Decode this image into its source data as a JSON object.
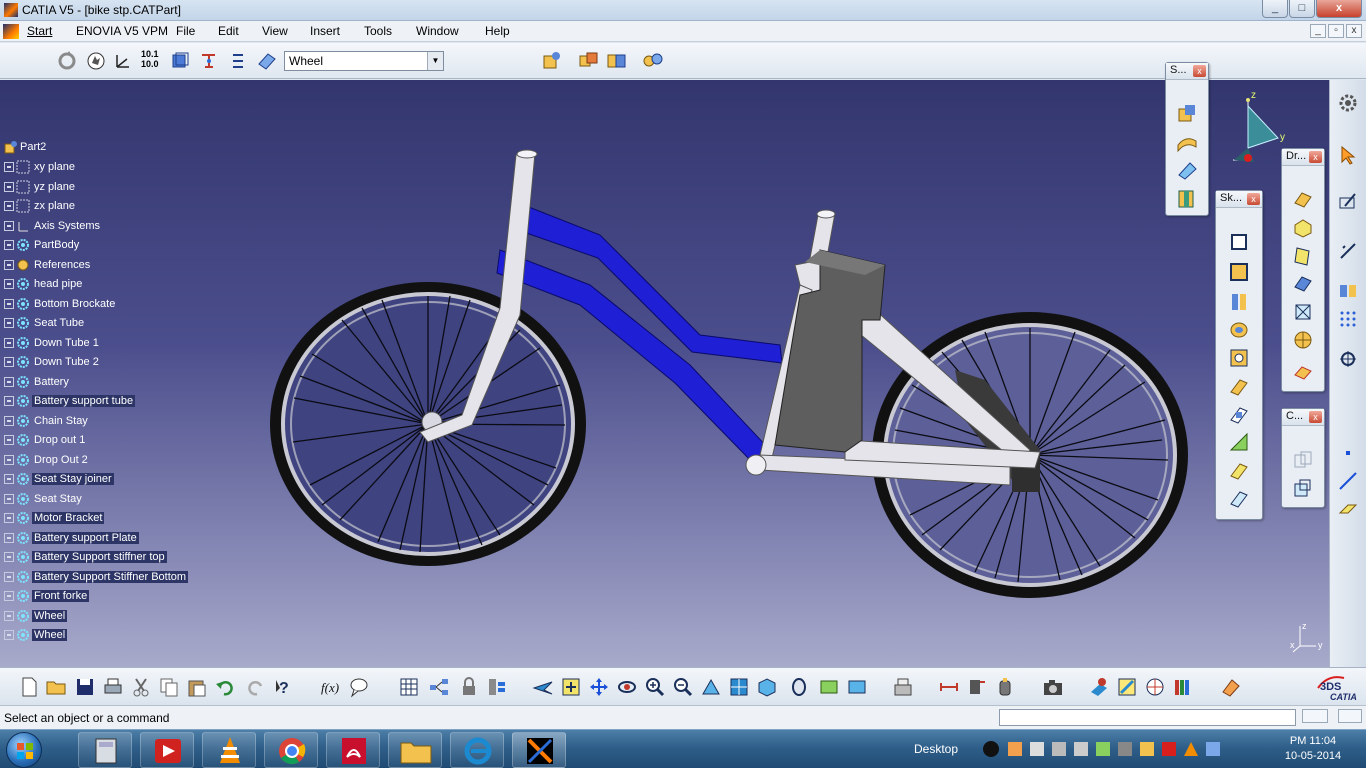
{
  "window": {
    "title": "CATIA V5 - [bike stp.CATPart]",
    "controls": {
      "minimize": "_",
      "restore": "□",
      "close": "x"
    }
  },
  "menu": {
    "items": [
      "Start",
      "ENOVIA V5 VPM",
      "File",
      "Edit",
      "View",
      "Insert",
      "Tools",
      "Window",
      "Help"
    ],
    "mdi": {
      "minimize": "_",
      "restore": "▫",
      "close": "x"
    }
  },
  "toolbar": {
    "selection_value": "Wheel",
    "select_arrow": "▼"
  },
  "tree": {
    "root": "Part2",
    "items": [
      {
        "label": "xy plane",
        "icon": "plane-icon",
        "selected": false
      },
      {
        "label": "yz plane",
        "icon": "plane-icon",
        "selected": false
      },
      {
        "label": "zx plane",
        "icon": "plane-icon",
        "selected": false
      },
      {
        "label": "Axis Systems",
        "icon": "axis-icon",
        "selected": false
      },
      {
        "label": "PartBody",
        "icon": "gear-body-icon",
        "selected": false
      },
      {
        "label": "References",
        "icon": "reference-icon",
        "selected": false
      },
      {
        "label": "head pipe",
        "icon": "gear-body-icon",
        "selected": false
      },
      {
        "label": "Bottom Brockate",
        "icon": "gear-body-icon",
        "selected": false
      },
      {
        "label": "Seat Tube",
        "icon": "gear-body-icon",
        "selected": false
      },
      {
        "label": "Down Tube 1",
        "icon": "gear-body-icon",
        "selected": false
      },
      {
        "label": "Down Tube 2",
        "icon": "gear-body-icon",
        "selected": false
      },
      {
        "label": "Battery",
        "icon": "gear-body-icon",
        "selected": false
      },
      {
        "label": "Battery support tube",
        "icon": "gear-body-icon",
        "selected": true
      },
      {
        "label": "Chain Stay",
        "icon": "gear-body-icon",
        "selected": false
      },
      {
        "label": "Drop out 1",
        "icon": "gear-body-icon",
        "selected": false
      },
      {
        "label": "Drop Out 2",
        "icon": "gear-body-icon",
        "selected": false
      },
      {
        "label": "Seat Stay joiner",
        "icon": "gear-body-icon",
        "selected": true
      },
      {
        "label": "Seat Stay",
        "icon": "gear-body-icon",
        "selected": false
      },
      {
        "label": "Motor Bracket",
        "icon": "gear-body-icon",
        "selected": true
      },
      {
        "label": "Battery support Plate",
        "icon": "gear-body-icon",
        "selected": true
      },
      {
        "label": "Battery Support stiffner top",
        "icon": "gear-body-icon",
        "selected": true
      },
      {
        "label": "Battery Support Stiffner Bottom",
        "icon": "gear-body-icon",
        "selected": true
      },
      {
        "label": "Front forke",
        "icon": "gear-body-icon",
        "selected": true
      },
      {
        "label": "Wheel",
        "icon": "gear-body-icon",
        "selected": true
      },
      {
        "label": "Wheel",
        "icon": "gear-body-icon",
        "selected": true
      }
    ]
  },
  "floating_toolbars": {
    "s": {
      "title": "S..."
    },
    "sk": {
      "title": "Sk..."
    },
    "dr": {
      "title": "Dr..."
    },
    "c": {
      "title": "C..."
    }
  },
  "compass": {
    "z": "z",
    "y": "y"
  },
  "triad": {
    "z": "z",
    "x": "x",
    "y": "y"
  },
  "catia_logo": "CATIA",
  "status": {
    "message": "Select an object or a command"
  },
  "taskbar": {
    "desktop_label": "Desktop",
    "time": "PM 11:04",
    "date": "10-05-2014"
  },
  "colors": {
    "viewport_top": "#33366e",
    "frame_blue": "#1f1fd6",
    "frame_white": "#e4e4ea",
    "battery_gray": "#5e5e5e"
  }
}
